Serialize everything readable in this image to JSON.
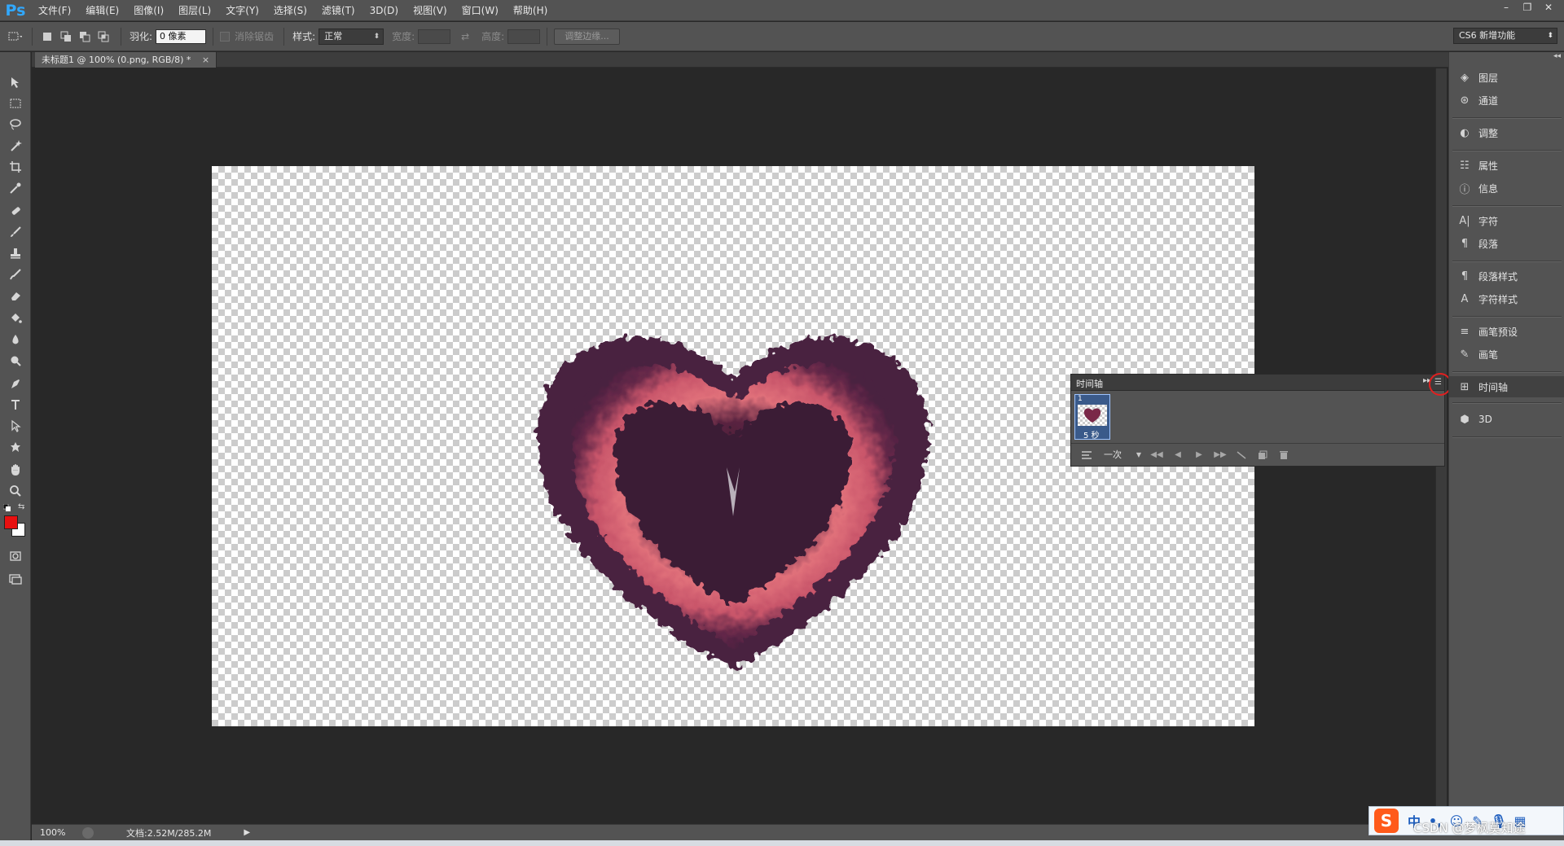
{
  "app": {
    "logo": "Ps"
  },
  "menu": [
    "文件(F)",
    "编辑(E)",
    "图像(I)",
    "图层(L)",
    "文字(Y)",
    "选择(S)",
    "滤镜(T)",
    "3D(D)",
    "视图(V)",
    "窗口(W)",
    "帮助(H)"
  ],
  "window_controls": [
    "–",
    "❐",
    "✕"
  ],
  "options": {
    "feather_label": "羽化:",
    "feather_value": "0 像素",
    "antialias_label": "消除锯齿",
    "style_label": "样式:",
    "style_value": "正常",
    "width_label": "宽度:",
    "height_label": "高度:",
    "refine_edge": "调整边缘...",
    "workspace": "CS6 新增功能"
  },
  "document": {
    "tab_title": "未标题1 @ 100% (0.png, RGB/8) *",
    "tab_close": "×"
  },
  "status": {
    "zoom": "100%",
    "doc_size": "文档:2.52M/285.2M"
  },
  "dock": {
    "items": [
      "图层",
      "通道",
      "调整",
      "属性",
      "信息",
      "字符",
      "段落",
      "段落样式",
      "字符样式",
      "画笔预设",
      "画笔",
      "时间轴",
      "3D"
    ],
    "active": "时间轴"
  },
  "timeline": {
    "title": "时间轴",
    "frame_number": "1",
    "frame_delay": "5 秒",
    "loop": "一次"
  },
  "ime": {
    "logo": "S",
    "mode": "中"
  },
  "watermark": "CSDN @梦枫莫知途",
  "colors": {
    "foreground": "#e81010",
    "background": "#ffffff",
    "panel": "#535353",
    "workspace_bg": "#282828",
    "highlight_circle": "#e02020"
  }
}
